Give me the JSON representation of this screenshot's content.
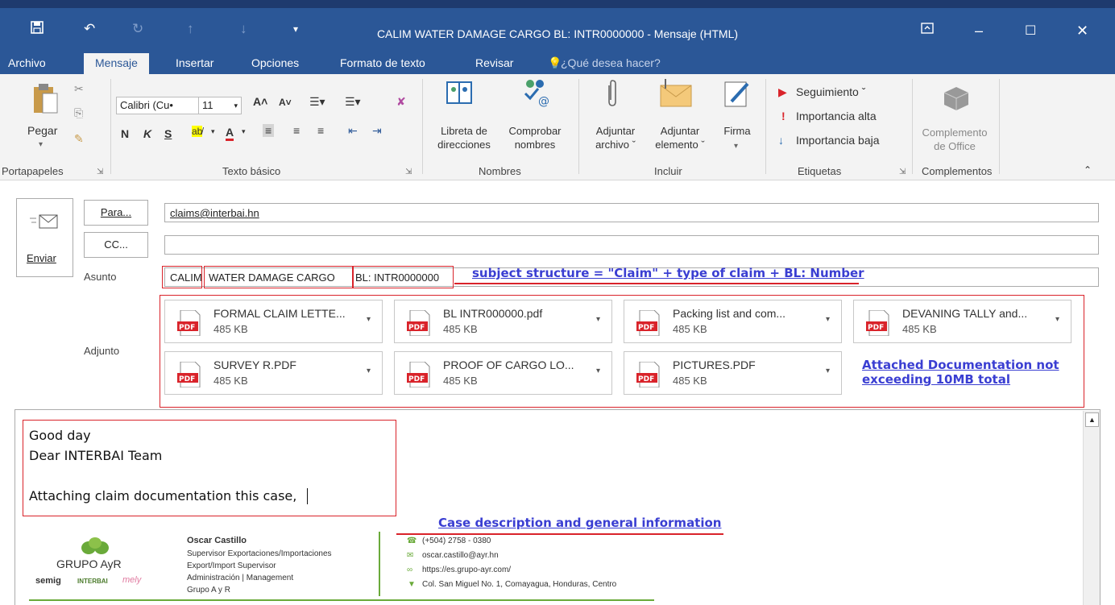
{
  "window": {
    "title": "CALIM WATER DAMAGE CARGO BL: INTR0000000 - Mensaje (HTML)"
  },
  "tabs": [
    {
      "label": "Archivo"
    },
    {
      "label": "Mensaje"
    },
    {
      "label": "Insertar"
    },
    {
      "label": "Opciones"
    },
    {
      "label": "Formato de texto"
    },
    {
      "label": "Revisar"
    }
  ],
  "tell_me": "¿Qué desea hacer?",
  "ribbon": {
    "paste_label": "Pegar",
    "font_name": "Calibri (Cu•",
    "font_size": "11",
    "bold": "N",
    "italic": "K",
    "underline": "S",
    "address_book_label_1": "Libreta de",
    "address_book_label_2": "direcciones",
    "check_names_label_1": "Comprobar",
    "check_names_label_2": "nombres",
    "attach_file_label_1": "Adjuntar",
    "attach_file_label_2": "archivo ˇ",
    "attach_item_label_1": "Adjuntar",
    "attach_item_label_2": "elemento ˇ",
    "signature_label": "Firma",
    "followup_label": "Seguimiento ˇ",
    "high_importance_label": "Importancia alta",
    "low_importance_label": "Importancia baja",
    "office_addin_label_1": "Complemento",
    "office_addin_label_2": "de Office",
    "groups": {
      "clipboard": "Portapapeles",
      "basic_text": "Texto básico",
      "names": "Nombres",
      "include": "Incluir",
      "tags": "Etiquetas",
      "addins": "Complementos"
    }
  },
  "compose": {
    "send_label": "Enviar",
    "to_button": "Para...",
    "cc_button": "CC...",
    "subject_label": "Asunto",
    "attachments_label": "Adjunto",
    "to_value": "claims@interbai.hn",
    "cc_value": "",
    "subject_part1": "CALIM",
    "subject_part2": "WATER DAMAGE CARGO",
    "subject_part3": "BL: INTR0000000"
  },
  "attachments": [
    {
      "name": "FORMAL CLAIM LETTE...",
      "size": "485 KB"
    },
    {
      "name": "BL INTR000000.pdf",
      "size": "485 KB"
    },
    {
      "name": "Packing list and com...",
      "size": "485 KB"
    },
    {
      "name": "DEVANING TALLY and...",
      "size": "485 KB"
    },
    {
      "name": "SURVEY R.PDF",
      "size": "485 KB"
    },
    {
      "name": "PROOF OF CARGO LO...",
      "size": "485 KB"
    },
    {
      "name": "PICTURES.PDF",
      "size": "485 KB"
    }
  ],
  "annotations": {
    "subject_structure": "subject structure = \"Claim\" + type of claim + BL: Number",
    "attached_docs_line1": "Attached Documentation not",
    "attached_docs_line2": "exceeding 10MB total",
    "case_description": "Case description and general information"
  },
  "body": {
    "line1": "Good day",
    "line2": "Dear INTERBAI Team",
    "line3": "Attaching claim documentation this case,"
  },
  "signature": {
    "company": "GRUPO AyR",
    "brand1": "semig",
    "brand2": "INTERBAI",
    "brand3": "mely",
    "name": "Oscar Castillo",
    "role1": "Supervisor Exportaciones/Importaciones",
    "role2": "Export/Import Supervisor",
    "role3": "Administración | Management",
    "org": "Grupo A y R",
    "phone": "(+504) 2758 - 0380",
    "email": "oscar.castillo@ayr.hn",
    "web": "https://es.grupo-ayr.com/",
    "address": "Col. San Miguel No. 1, Comayagua, Honduras, Centro"
  },
  "colors": {
    "titlebar": "#2b5797",
    "annotation": "#3a3ed2",
    "highlight_box": "#d9232a",
    "pdf_red": "#d9232a"
  }
}
